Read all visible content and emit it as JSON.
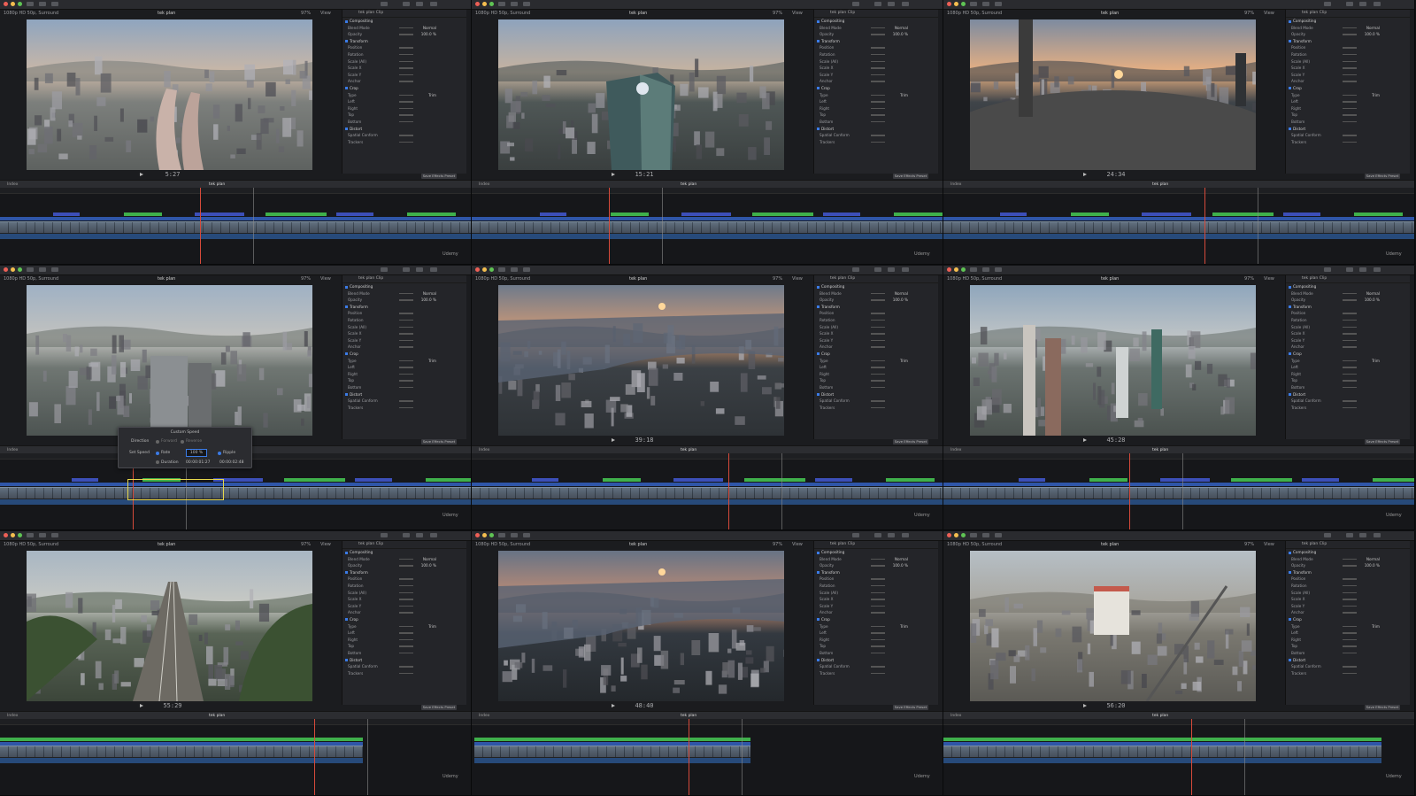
{
  "window": {
    "format_label": "1080p HD 50p, Surround",
    "project_name": "tek plan",
    "zoom": "97%",
    "view_label": "View",
    "index_label": "Index"
  },
  "inspector": {
    "clip_label": "tek plan Clip",
    "sections": {
      "compositing": "Compositing",
      "blend_mode": "Blend Mode",
      "blend_value": "Normal",
      "opacity": "Opacity",
      "opacity_value": "100.0 %",
      "transform": "Transform",
      "position": "Position",
      "rotation": "Rotation",
      "scale_all": "Scale (All)",
      "scale_x": "Scale X",
      "scale_y": "Scale Y",
      "anchor": "Anchor",
      "crop": "Crop",
      "type": "Type",
      "type_value": "Trim",
      "left": "Left",
      "right": "Right",
      "top": "Top",
      "bottom": "Bottom",
      "distort": "Distort",
      "spatial": "Spatial Conform",
      "trackers": "Trackers",
      "save_preset": "Save Effects Preset"
    }
  },
  "panels": [
    {
      "timecode": "5:27",
      "scene": "city"
    },
    {
      "timecode": "15:21",
      "scene": "tower"
    },
    {
      "timecode": "24:34",
      "scene": "sunset-top"
    },
    {
      "timecode": "",
      "scene": "city2"
    },
    {
      "timecode": "39:18",
      "scene": "harbor"
    },
    {
      "timecode": "45:28",
      "scene": "skyscrapers"
    },
    {
      "timecode": "55:29",
      "scene": "rail"
    },
    {
      "timecode": "48:40",
      "scene": "bay"
    },
    {
      "timecode": "56:20",
      "scene": "neighborhood"
    }
  ],
  "watermark": "Udemy",
  "speed_popup": {
    "title": "Custom Speed",
    "direction": "Direction",
    "forward": "Forward",
    "reverse": "Reverse",
    "set_speed": "Set Speed",
    "rate": "Rate",
    "rate_value": "100 %",
    "ripple": "Ripple",
    "duration": "Duration",
    "dur_a": "00:00:01:27",
    "dur_b": "00:00:02:48"
  },
  "colors": {
    "playhead": "#d64a3a",
    "accent_blue": "#3b7be6",
    "title_blue": "#3c4fb8",
    "green": "#3fb04b",
    "selection": "#e7d84d"
  }
}
